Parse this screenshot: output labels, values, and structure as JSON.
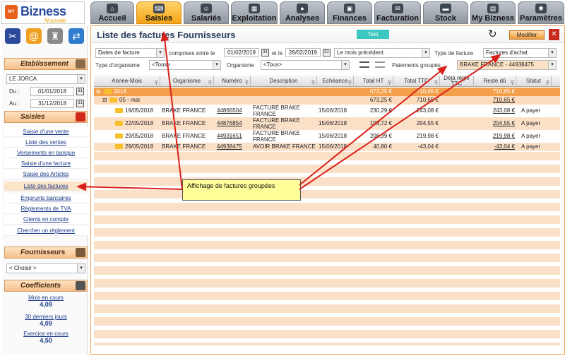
{
  "logo": {
    "brand": "Bizness",
    "tagline": "Nouvelle",
    "mark": "MY"
  },
  "tabs": [
    {
      "label": "Accueil",
      "icon": "home-icon"
    },
    {
      "label": "Saisies",
      "icon": "keyboard-icon"
    },
    {
      "label": "Salariés",
      "icon": "people-icon"
    },
    {
      "label": "Exploitation",
      "icon": "building-icon"
    },
    {
      "label": "Analyses",
      "icon": "coins-icon"
    },
    {
      "label": "Finances",
      "icon": "bank-icon"
    },
    {
      "label": "Facturation",
      "icon": "invoice-icon"
    },
    {
      "label": "Stock",
      "icon": "truck-icon"
    },
    {
      "label": "My Bizness",
      "icon": "book-icon"
    },
    {
      "label": "Paramètres",
      "icon": "gear-icon"
    }
  ],
  "sidebar": {
    "etab_title": "Etablissement",
    "etab_value": "LE JORCA",
    "du_label": "Du :",
    "du_value": "01/01/2018",
    "au_label": "Au :",
    "au_value": "31/12/2018",
    "saisies_title": "Saisies",
    "menu": [
      "Saisie d'une vente",
      "Liste des ventes",
      "Versements en banque",
      "Saisie d'une facture",
      "Saisie des Articles",
      "Liste des factures",
      "Emprunts bancaires",
      "Règlements de TVA",
      "Clients en compte",
      "Chercher un règlement"
    ],
    "fourn_title": "Fournisseurs",
    "fourn_value": "< Choisir >",
    "coef_title": "Coefficients",
    "coefs": [
      {
        "name": "Mois en cours",
        "value": "4,09"
      },
      {
        "name": "30 derniers jours",
        "value": "4,09"
      },
      {
        "name": "Exercice en cours",
        "value": "4,50"
      }
    ]
  },
  "page": {
    "title": "Liste des factures Fournisseurs",
    "test_label": "Test",
    "modifier_label": "Modifier",
    "close_glyph": "✕",
    "refresh_glyph": "↻"
  },
  "filters": {
    "date_type": "Dates de facture",
    "between": "comprises entre le",
    "date_from": "01/02/2019",
    "et": "et le",
    "date_to": "28/02/2019",
    "period": "Le mois précédent",
    "type_label": "Type de facture",
    "type_value": "Factures d'achat",
    "org_type_label": "Type d'organisme",
    "org_type_value": "<Tous>",
    "org_label": "Organisme",
    "org_value": "<Tous>",
    "paiements_label": "Paiements groupés :",
    "paiements_value": "BRAKE FRANCE - 44938475"
  },
  "grid": {
    "columns": [
      "Année-Mois",
      "Organisme",
      "Numéro",
      "Description",
      "Echéance",
      "Total HT",
      "Total TTC",
      "Déjà réglé TTC",
      "Reste dû",
      "Statut"
    ],
    "group_year": {
      "label": "2018",
      "ht": "673,25 €",
      "ttc": "710,65 €",
      "reste": "710,65 €"
    },
    "group_month": {
      "label": "05 - mai",
      "ht": "673,25 €",
      "ttc": "710,65 €",
      "reste": "710,65 €"
    },
    "rows": [
      {
        "date": "19/05/2018",
        "org": "BRAKE FRANCE",
        "num": "44866504",
        "desc": "FACTURE BRAKE FRANCE",
        "ech": "15/06/2018",
        "ht": "230,29 €",
        "ttc": "243,08 €",
        "reste": "243,08 €",
        "statut": "A payer"
      },
      {
        "date": "22/05/2018",
        "org": "BRAKE FRANCE",
        "num": "44876854",
        "desc": "FACTURE BRAKE FRANCE",
        "ech": "15/06/2018",
        "ht": "193,72 €",
        "ttc": "204,55 €",
        "reste": "204,55 €",
        "statut": "A payer"
      },
      {
        "date": "29/05/2018",
        "org": "BRAKE FRANCE",
        "num": "44931651",
        "desc": "FACTURE BRAKE FRANCE",
        "ech": "15/06/2018",
        "ht": "208,39 €",
        "ttc": "219,98 €",
        "reste": "219,98 €",
        "statut": "A payer"
      },
      {
        "date": "29/05/2018",
        "org": "BRAKE FRANCE",
        "num": "44938475",
        "desc": "AVOIR BRAKE FRANCE",
        "ech": "15/06/2018",
        "ht": "40,80 €",
        "ttc": "-43,04 €",
        "reste": "-43,04 €",
        "statut": "A payer"
      }
    ]
  },
  "annotation": {
    "text": "Affichage de factures groupées"
  },
  "colors": {
    "accent": "#f4a316",
    "arrow": "#d9211c",
    "link": "#1a3a8a"
  }
}
